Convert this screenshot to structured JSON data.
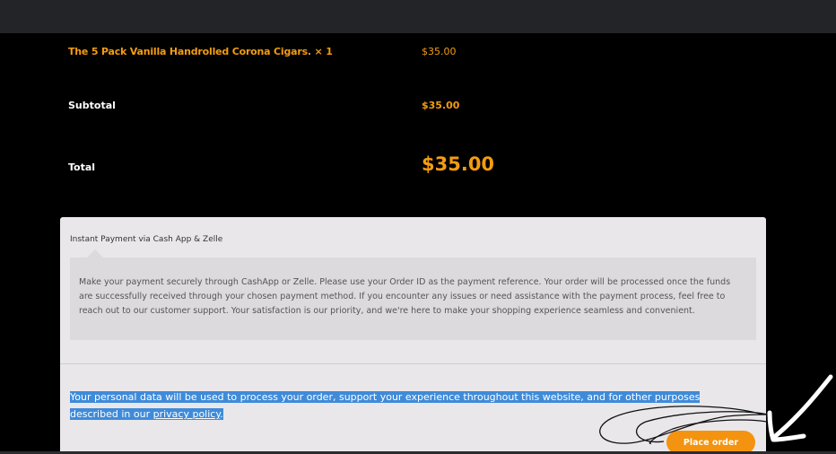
{
  "order": {
    "product_name": "The 5 Pack Vanilla Handrolled Corona Cigars.",
    "product_qty": "× 1",
    "product_price": "$35.00",
    "subtotal_label": "Subtotal",
    "subtotal_value": "$35.00",
    "total_label": "Total",
    "total_value": "$35.00"
  },
  "payment": {
    "method_label": "Instant Payment via Cash App & Zelle",
    "method_description": "Make your payment securely through CashApp or Zelle. Please use your Order ID as the payment reference. Your order will be processed once the funds are successfully received through your chosen payment method. If you encounter any issues or need assistance with the payment process, feel free to reach out to our customer support. Your satisfaction is our priority, and we're here to make your shopping experience seamless and convenient.",
    "privacy_text": "Your personal data will be used to process your order, support your experience throughout this website, and for other purposes described in our ",
    "privacy_link": "privacy policy",
    "privacy_end": ".",
    "place_order_label": "Place order"
  },
  "colors": {
    "accent": "#f4930f",
    "background": "#000000",
    "selection": "#3f8bd9"
  }
}
